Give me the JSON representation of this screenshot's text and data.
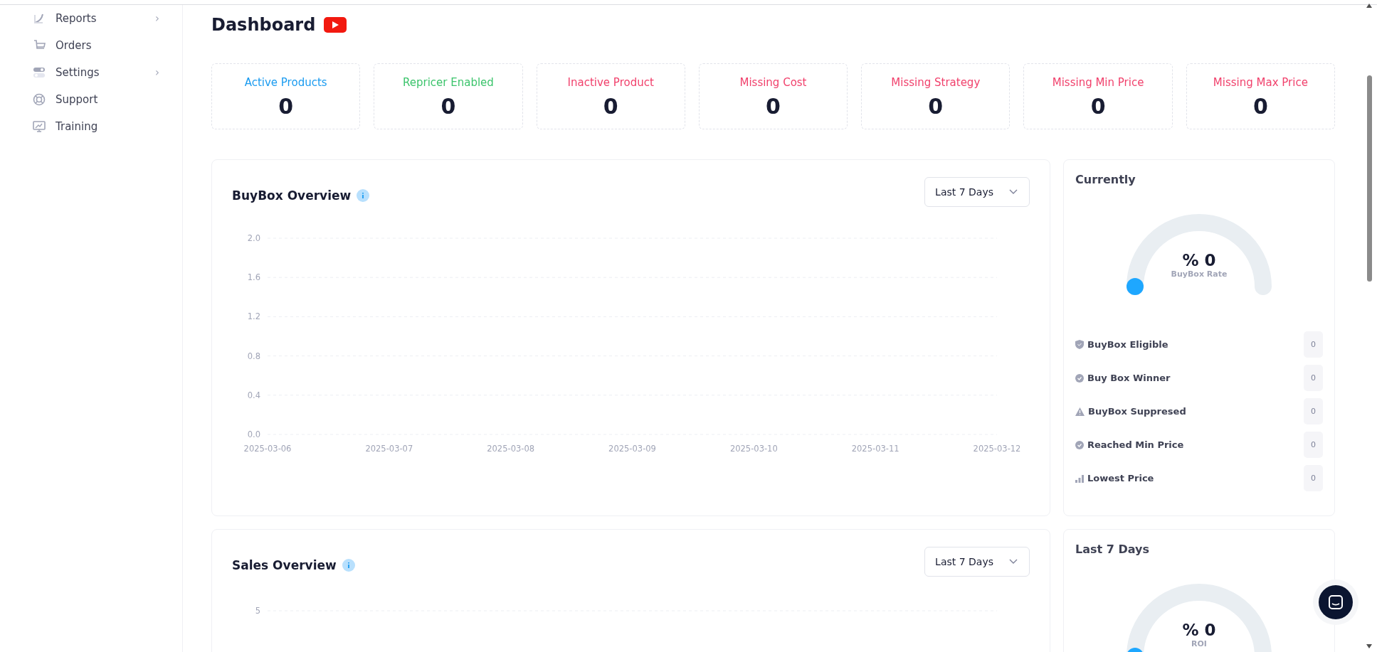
{
  "sidebar": {
    "items": [
      {
        "label": "Reports",
        "submenu_icon": "›"
      },
      {
        "label": "Orders"
      },
      {
        "label": "Settings",
        "submenu_icon": "›"
      },
      {
        "label": "Support"
      },
      {
        "label": "Training"
      }
    ]
  },
  "page": {
    "title": "Dashboard"
  },
  "stat_cards": [
    {
      "label": "Active Products",
      "value": "0",
      "color": "#1a9bf0"
    },
    {
      "label": "Repricer Enabled",
      "value": "0",
      "color": "#3cc46c"
    },
    {
      "label": "Inactive Product",
      "value": "0",
      "color": "#f1416c"
    },
    {
      "label": "Missing Cost",
      "value": "0",
      "color": "#f1416c"
    },
    {
      "label": "Missing Strategy",
      "value": "0",
      "color": "#f1416c"
    },
    {
      "label": "Missing Min Price",
      "value": "0",
      "color": "#f1416c"
    },
    {
      "label": "Missing Max Price",
      "value": "0",
      "color": "#f1416c"
    }
  ],
  "sections": [
    {
      "title": "BuyBox Overview",
      "period": "Last 7 Days",
      "chart_data": {
        "type": "line",
        "grid": true,
        "categories": [
          "2025-03-06",
          "2025-03-07",
          "2025-03-08",
          "2025-03-09",
          "2025-03-10",
          "2025-03-11",
          "2025-03-12"
        ],
        "ylim": [
          0,
          2
        ],
        "yticks": [
          {
            "value": 0,
            "label": "0.0"
          },
          {
            "value": 0.4,
            "label": "0.4"
          },
          {
            "value": 0.8,
            "label": "0.8"
          },
          {
            "value": 1.2,
            "label": "1.2"
          },
          {
            "value": 1.6,
            "label": "1.6"
          },
          {
            "value": 2,
            "label": "2.0"
          }
        ]
      },
      "side": {
        "title": "Currently",
        "gauge": {
          "value": "% 0",
          "label": "BuyBox Rate",
          "level": 0
        },
        "stats": [
          {
            "label": "BuyBox Eligible",
            "value": "0"
          },
          {
            "label": "Buy Box Winner",
            "value": "0"
          },
          {
            "label": "BuyBox Suppresed",
            "value": "0"
          },
          {
            "label": "Reached Min Price",
            "value": "0"
          },
          {
            "label": "Lowest Price",
            "value": "0"
          }
        ]
      }
    },
    {
      "title": "Sales Overview",
      "period": "Last 7 Days",
      "axis_label": "5",
      "side": {
        "title": "Last 7 Days",
        "gauge": {
          "value": "% 0",
          "label": "ROI",
          "level": 0
        }
      }
    }
  ]
}
